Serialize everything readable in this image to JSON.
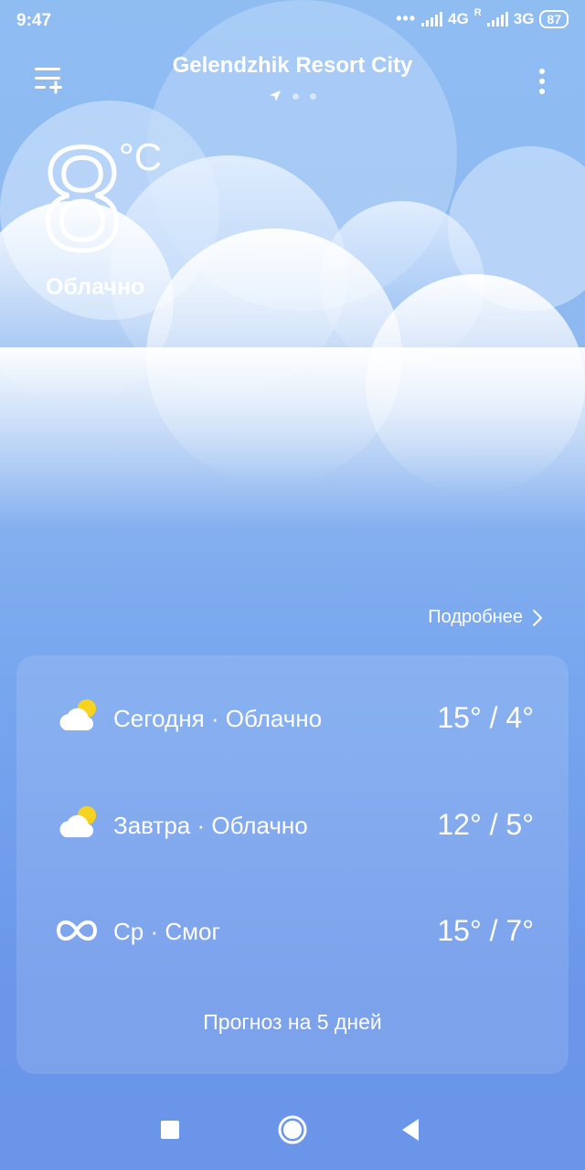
{
  "status_bar": {
    "time": "9:47",
    "net1": "4G",
    "roaming": "R",
    "net2": "3G",
    "battery": "87"
  },
  "header": {
    "city": "Gelendzhik Resort City"
  },
  "current": {
    "temperature": "8",
    "unit": "°C",
    "condition": "Облачно"
  },
  "details_link": "Подробнее",
  "forecast": [
    {
      "label": "Сегодня · Облачно",
      "range": "15° / 4°",
      "icon": "partly-cloudy-icon"
    },
    {
      "label": "Завтра · Облачно",
      "range": "12° / 5°",
      "icon": "partly-cloudy-icon"
    },
    {
      "label": "Ср · Смог",
      "range": "15° / 7°",
      "icon": "smog-icon"
    }
  ],
  "forecast_button": "Прогноз на 5 дней",
  "colors": {
    "sky_top": "#8fbdf2",
    "sky_bottom": "#6a95e9",
    "sun": "#f7d21e"
  }
}
